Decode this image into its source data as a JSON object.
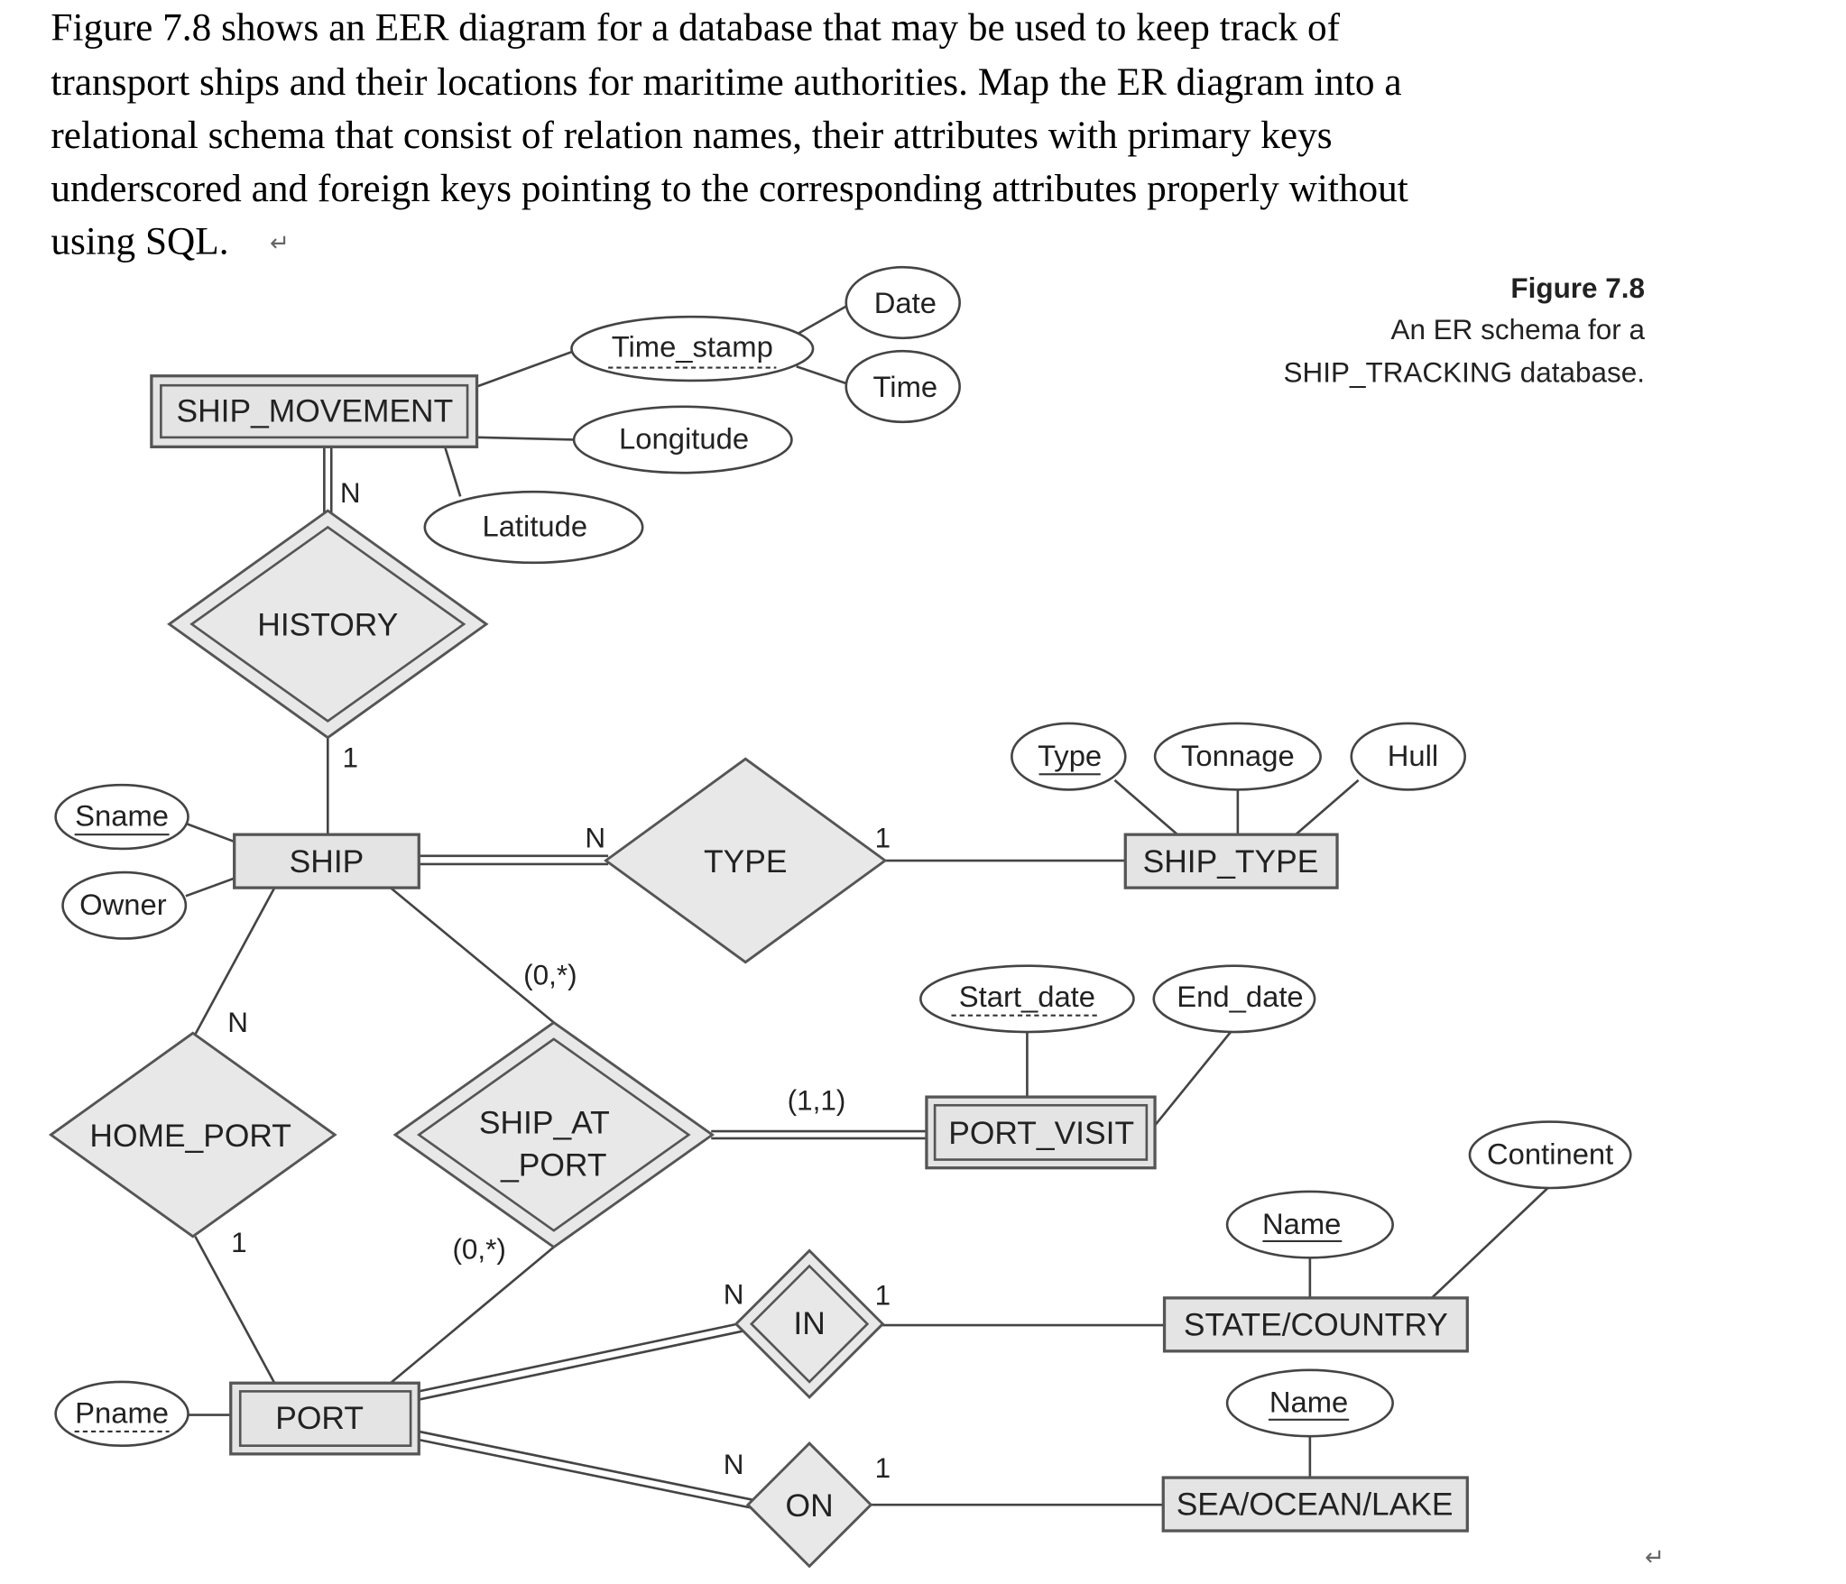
{
  "question": {
    "lines": [
      "Figure 7.8 shows an EER diagram for a database that may be used to keep track of",
      "transport ships and their locations for maritime authorities. Map the ER diagram into a",
      "relational schema that consist of relation names, their attributes with primary keys",
      "underscored and foreign keys pointing to the corresponding attributes properly without",
      "using SQL."
    ],
    "return_mark": "↵"
  },
  "caption": {
    "figure": "Figure 7.8",
    "line1": "An ER schema for a",
    "line2": "SHIP_TRACKING database."
  },
  "entities": {
    "ship_movement": "SHIP_MOVEMENT",
    "ship": "SHIP",
    "ship_type": "SHIP_TYPE",
    "port_visit": "PORT_VISIT",
    "port": "PORT",
    "state_country": "STATE/COUNTRY",
    "sea_ocean_lake": "SEA/OCEAN/LAKE"
  },
  "relationships": {
    "history": "HISTORY",
    "type": "TYPE",
    "home_port": "HOME_PORT",
    "ship_at_port_1": "SHIP_AT",
    "ship_at_port_2": "_PORT",
    "in": "IN",
    "on": "ON"
  },
  "attributes": {
    "time_stamp": "Time_stamp",
    "date": "Date",
    "time": "Time",
    "longitude": "Longitude",
    "latitude": "Latitude",
    "sname": "Sname",
    "owner": "Owner",
    "type": "Type",
    "tonnage": "Tonnage",
    "hull": "Hull",
    "start_date": "Start_date",
    "end_date": "End_date",
    "pname": "Pname",
    "sc_name": "Name",
    "continent": "Continent",
    "sol_name": "Name"
  },
  "cardinalities": {
    "history_sm": "N",
    "history_ship": "1",
    "type_ship": "N",
    "type_shiptype": "1",
    "homeport_ship": "N",
    "homeport_port": "1",
    "sap_ship": "(0,*)",
    "sap_port": "(0,*)",
    "sap_visit": "(1,1)",
    "in_port": "N",
    "in_state": "1",
    "on_port": "N",
    "on_sea": "1"
  }
}
